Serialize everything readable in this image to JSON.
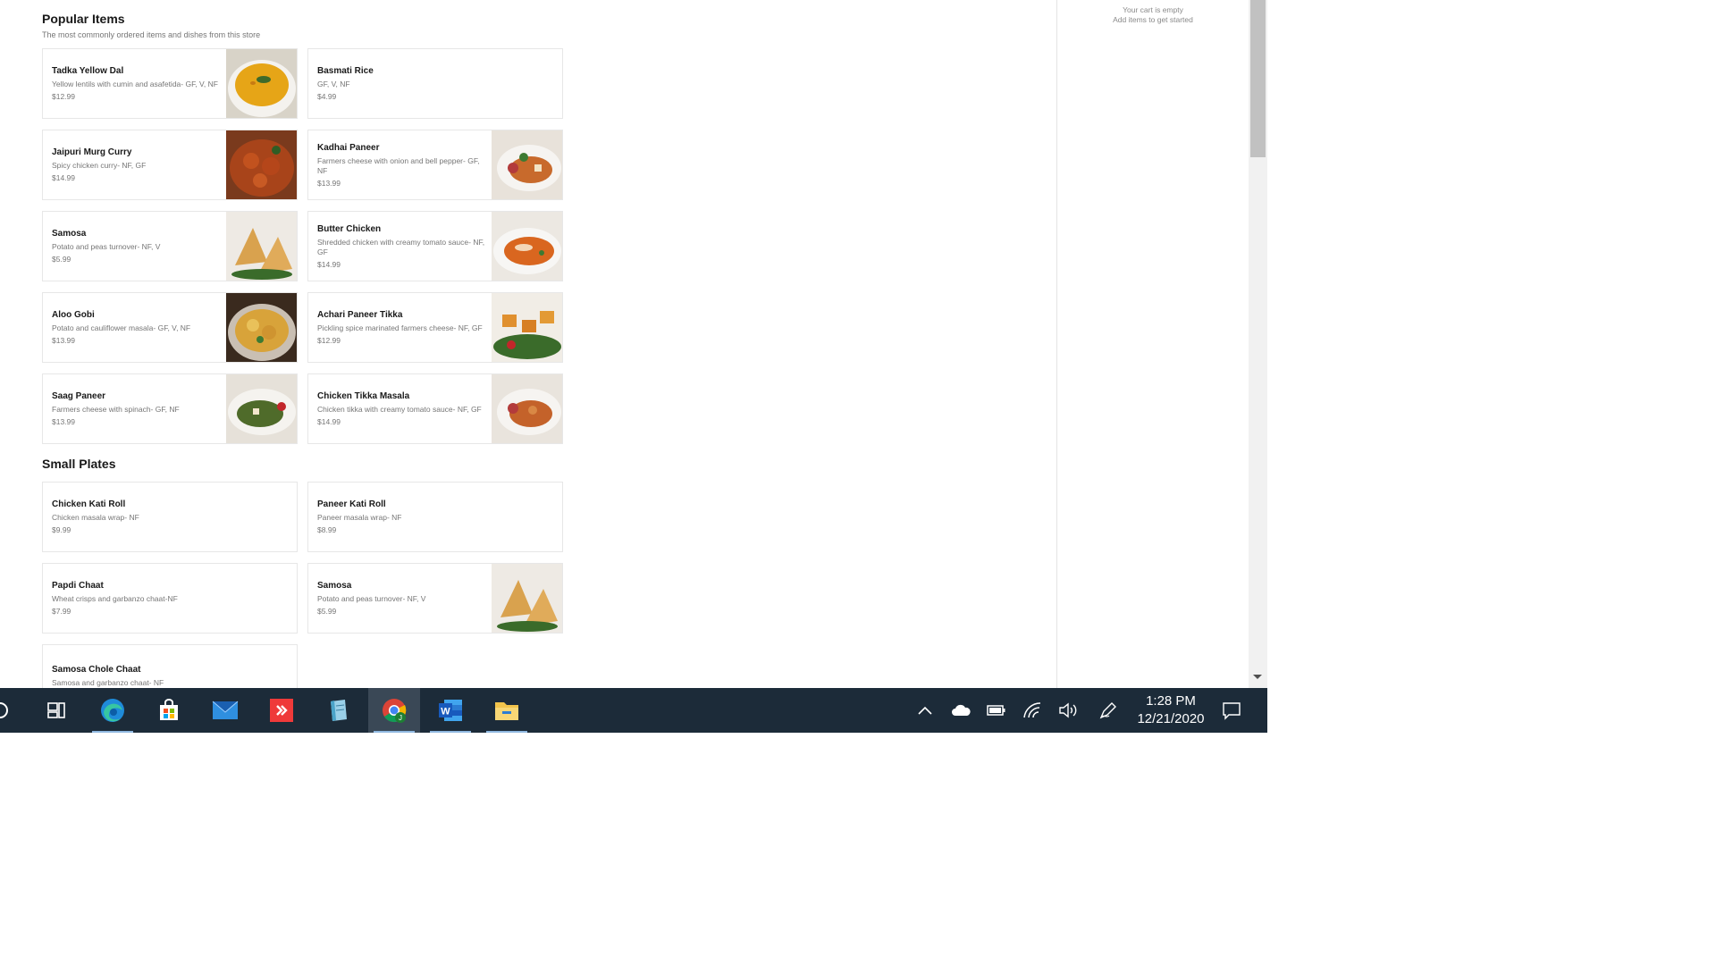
{
  "sections": [
    {
      "title": "Popular Items",
      "subtitle": "The most commonly ordered items and dishes from this store"
    },
    {
      "title": "Small Plates"
    }
  ],
  "items": [
    {
      "name": "Tadka Yellow Dal",
      "desc": "Yellow lentils with cumin and asafetida- GF, V, NF",
      "price": "$12.99",
      "image": "dal-dish-photo"
    },
    {
      "name": "Basmati Rice",
      "desc": "GF, V, NF",
      "price": "$4.99"
    },
    {
      "name": "Jaipuri Murg Curry",
      "desc": "Spicy chicken curry- NF, GF",
      "price": "$14.99",
      "image": "chicken-curry-photo"
    },
    {
      "name": "Kadhai Paneer",
      "desc": "Farmers cheese with onion and bell pepper- GF, NF",
      "price": "$13.99",
      "image": "paneer-dish-photo"
    },
    {
      "name": "Samosa",
      "desc": "Potato and peas turnover- NF, V",
      "price": "$5.99",
      "image": "samosa-photo"
    },
    {
      "name": "Butter Chicken",
      "desc": "Shredded chicken with creamy tomato sauce- NF, GF",
      "price": "$14.99",
      "image": "butter-chicken-photo"
    },
    {
      "name": "Aloo Gobi",
      "desc": "Potato and cauliflower masala- GF, V, NF",
      "price": "$13.99",
      "image": "aloo-gobi-photo"
    },
    {
      "name": "Achari Paneer Tikka",
      "desc": "Pickling spice marinated farmers cheese- NF, GF",
      "price": "$12.99",
      "image": "paneer-tikka-photo"
    },
    {
      "name": "Saag Paneer",
      "desc": "Farmers cheese with spinach- GF, NF",
      "price": "$13.99",
      "image": "saag-paneer-photo"
    },
    {
      "name": "Chicken Tikka Masala",
      "desc": "Chicken tikka with creamy tomato sauce- NF, GF",
      "price": "$14.99",
      "image": "tikka-masala-photo"
    },
    {
      "name": "Chicken Kati Roll",
      "desc": "Chicken masala wrap- NF",
      "price": "$9.99"
    },
    {
      "name": "Paneer Kati Roll",
      "desc": "Paneer masala wrap- NF",
      "price": "$8.99"
    },
    {
      "name": "Papdi Chaat",
      "desc": "Wheat crisps and garbanzo chaat-NF",
      "price": "$7.99"
    },
    {
      "name": "Samosa",
      "desc": "Potato and peas turnover- NF, V",
      "price": "$5.99",
      "image": "samosa-photo"
    },
    {
      "name": "Samosa Chole Chaat",
      "desc": "Samosa and garbanzo chaat- NF",
      "price": ""
    }
  ],
  "cart": {
    "line1": "Your cart is empty",
    "line2": "Add items to get started"
  },
  "taskbar": {
    "apps": [
      "search-icon",
      "task-view-icon",
      "edge-icon",
      "store-icon",
      "mail-icon",
      "anydesk-icon",
      "notepad-icon",
      "chrome-icon",
      "word-icon",
      "file-explorer-icon"
    ],
    "tray": [
      "chevron-up-icon",
      "onedrive-icon",
      "battery-icon",
      "wifi-icon",
      "volume-icon",
      "pen-icon",
      "notification-icon"
    ],
    "time": "1:28 PM",
    "date": "12/21/2020"
  },
  "colors": {
    "taskbar_bg": "#1c2b39",
    "active_tab": "#3a4856",
    "card_border": "#e7e7e7",
    "muted_text": "#767676"
  }
}
